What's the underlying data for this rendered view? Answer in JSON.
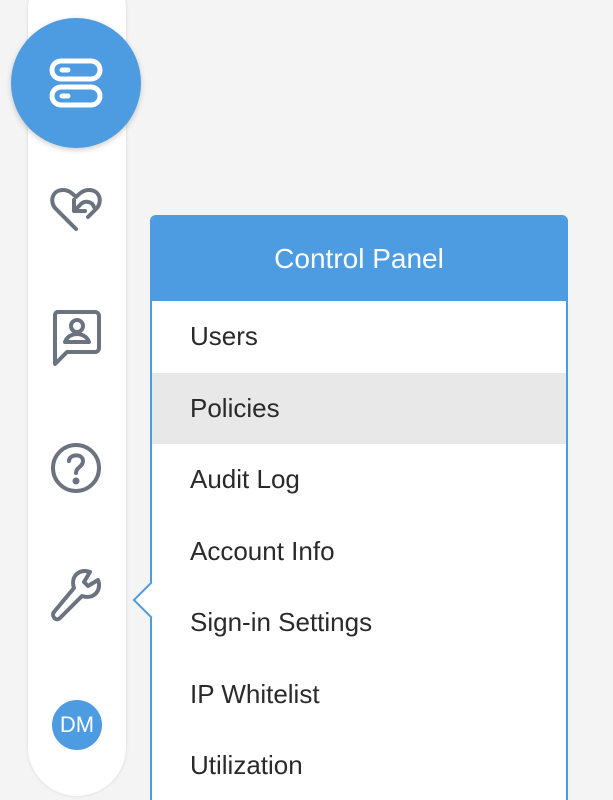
{
  "sidebar": {
    "logo_icon": "server-stack-icon",
    "icons": [
      {
        "name": "heart-refresh-icon"
      },
      {
        "name": "contact-card-icon"
      },
      {
        "name": "help-circle-icon"
      },
      {
        "name": "wrench-icon"
      }
    ],
    "avatar_initials": "DM",
    "accent_color": "#4d9be0"
  },
  "control_panel": {
    "title": "Control Panel",
    "items": [
      {
        "label": "Users"
      },
      {
        "label": "Policies",
        "selected": true
      },
      {
        "label": "Audit Log"
      },
      {
        "label": "Account Info"
      },
      {
        "label": "Sign-in Settings"
      },
      {
        "label": "IP Whitelist"
      },
      {
        "label": "Utilization"
      }
    ]
  }
}
